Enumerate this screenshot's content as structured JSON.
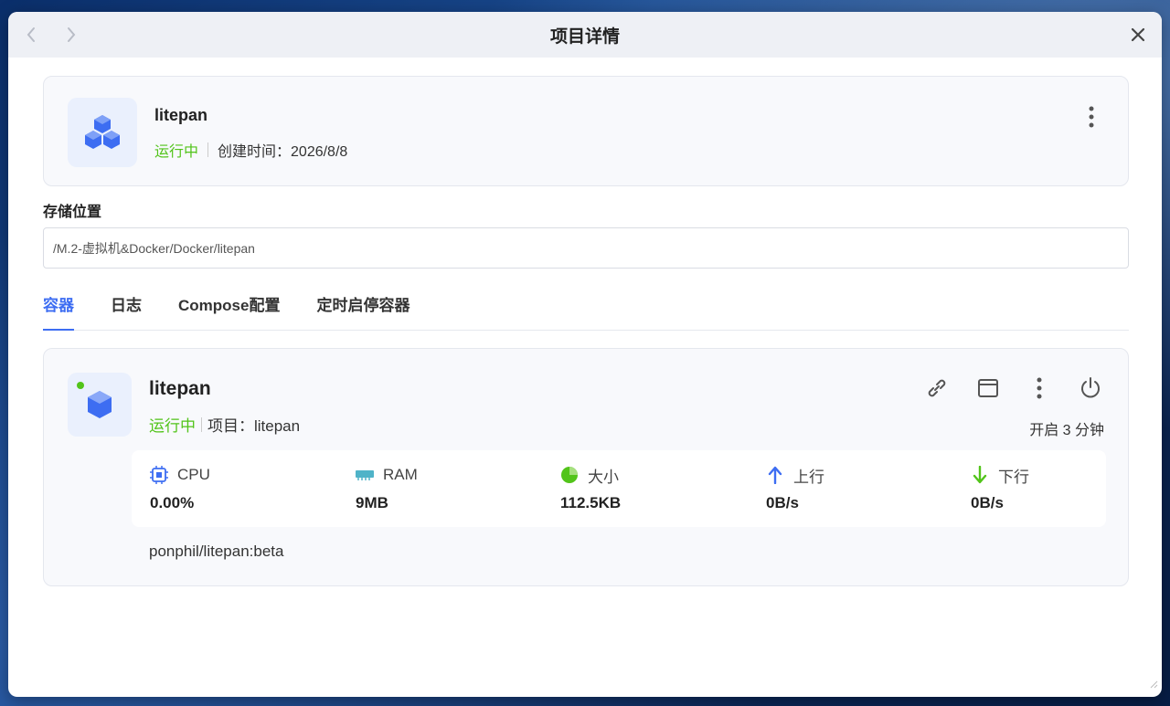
{
  "window": {
    "title": "项目详情"
  },
  "project": {
    "name": "litepan",
    "status": "运行中",
    "created": "创建时间：2026/8/8"
  },
  "storage": {
    "label": "存储位置",
    "path": "/M.2-虚拟机&Docker/Docker/litepan"
  },
  "tabs": [
    {
      "label": "容器",
      "active": true
    },
    {
      "label": "日志",
      "active": false
    },
    {
      "label": "Compose配置",
      "active": false
    },
    {
      "label": "定时启停容器",
      "active": false
    }
  ],
  "container": {
    "name": "litepan",
    "status": "运行中",
    "project": "项目：litepan",
    "uptime": "开启 3 分钟",
    "image": "ponphil/litepan:beta",
    "stats": [
      {
        "label": "CPU",
        "value": "0.00%",
        "icon": "cpu-icon"
      },
      {
        "label": "RAM",
        "value": "9MB",
        "icon": "ram-icon"
      },
      {
        "label": "大小",
        "value": "112.5KB",
        "icon": "pie-icon"
      },
      {
        "label": "上行",
        "value": "0B/s",
        "icon": "arrow-up-icon"
      },
      {
        "label": "下行",
        "value": "0B/s",
        "icon": "arrow-down-icon"
      }
    ]
  },
  "colors": {
    "accent": "#3d6df2",
    "running": "#52c41a",
    "upload": "#3d6df2",
    "download": "#52c41a"
  }
}
